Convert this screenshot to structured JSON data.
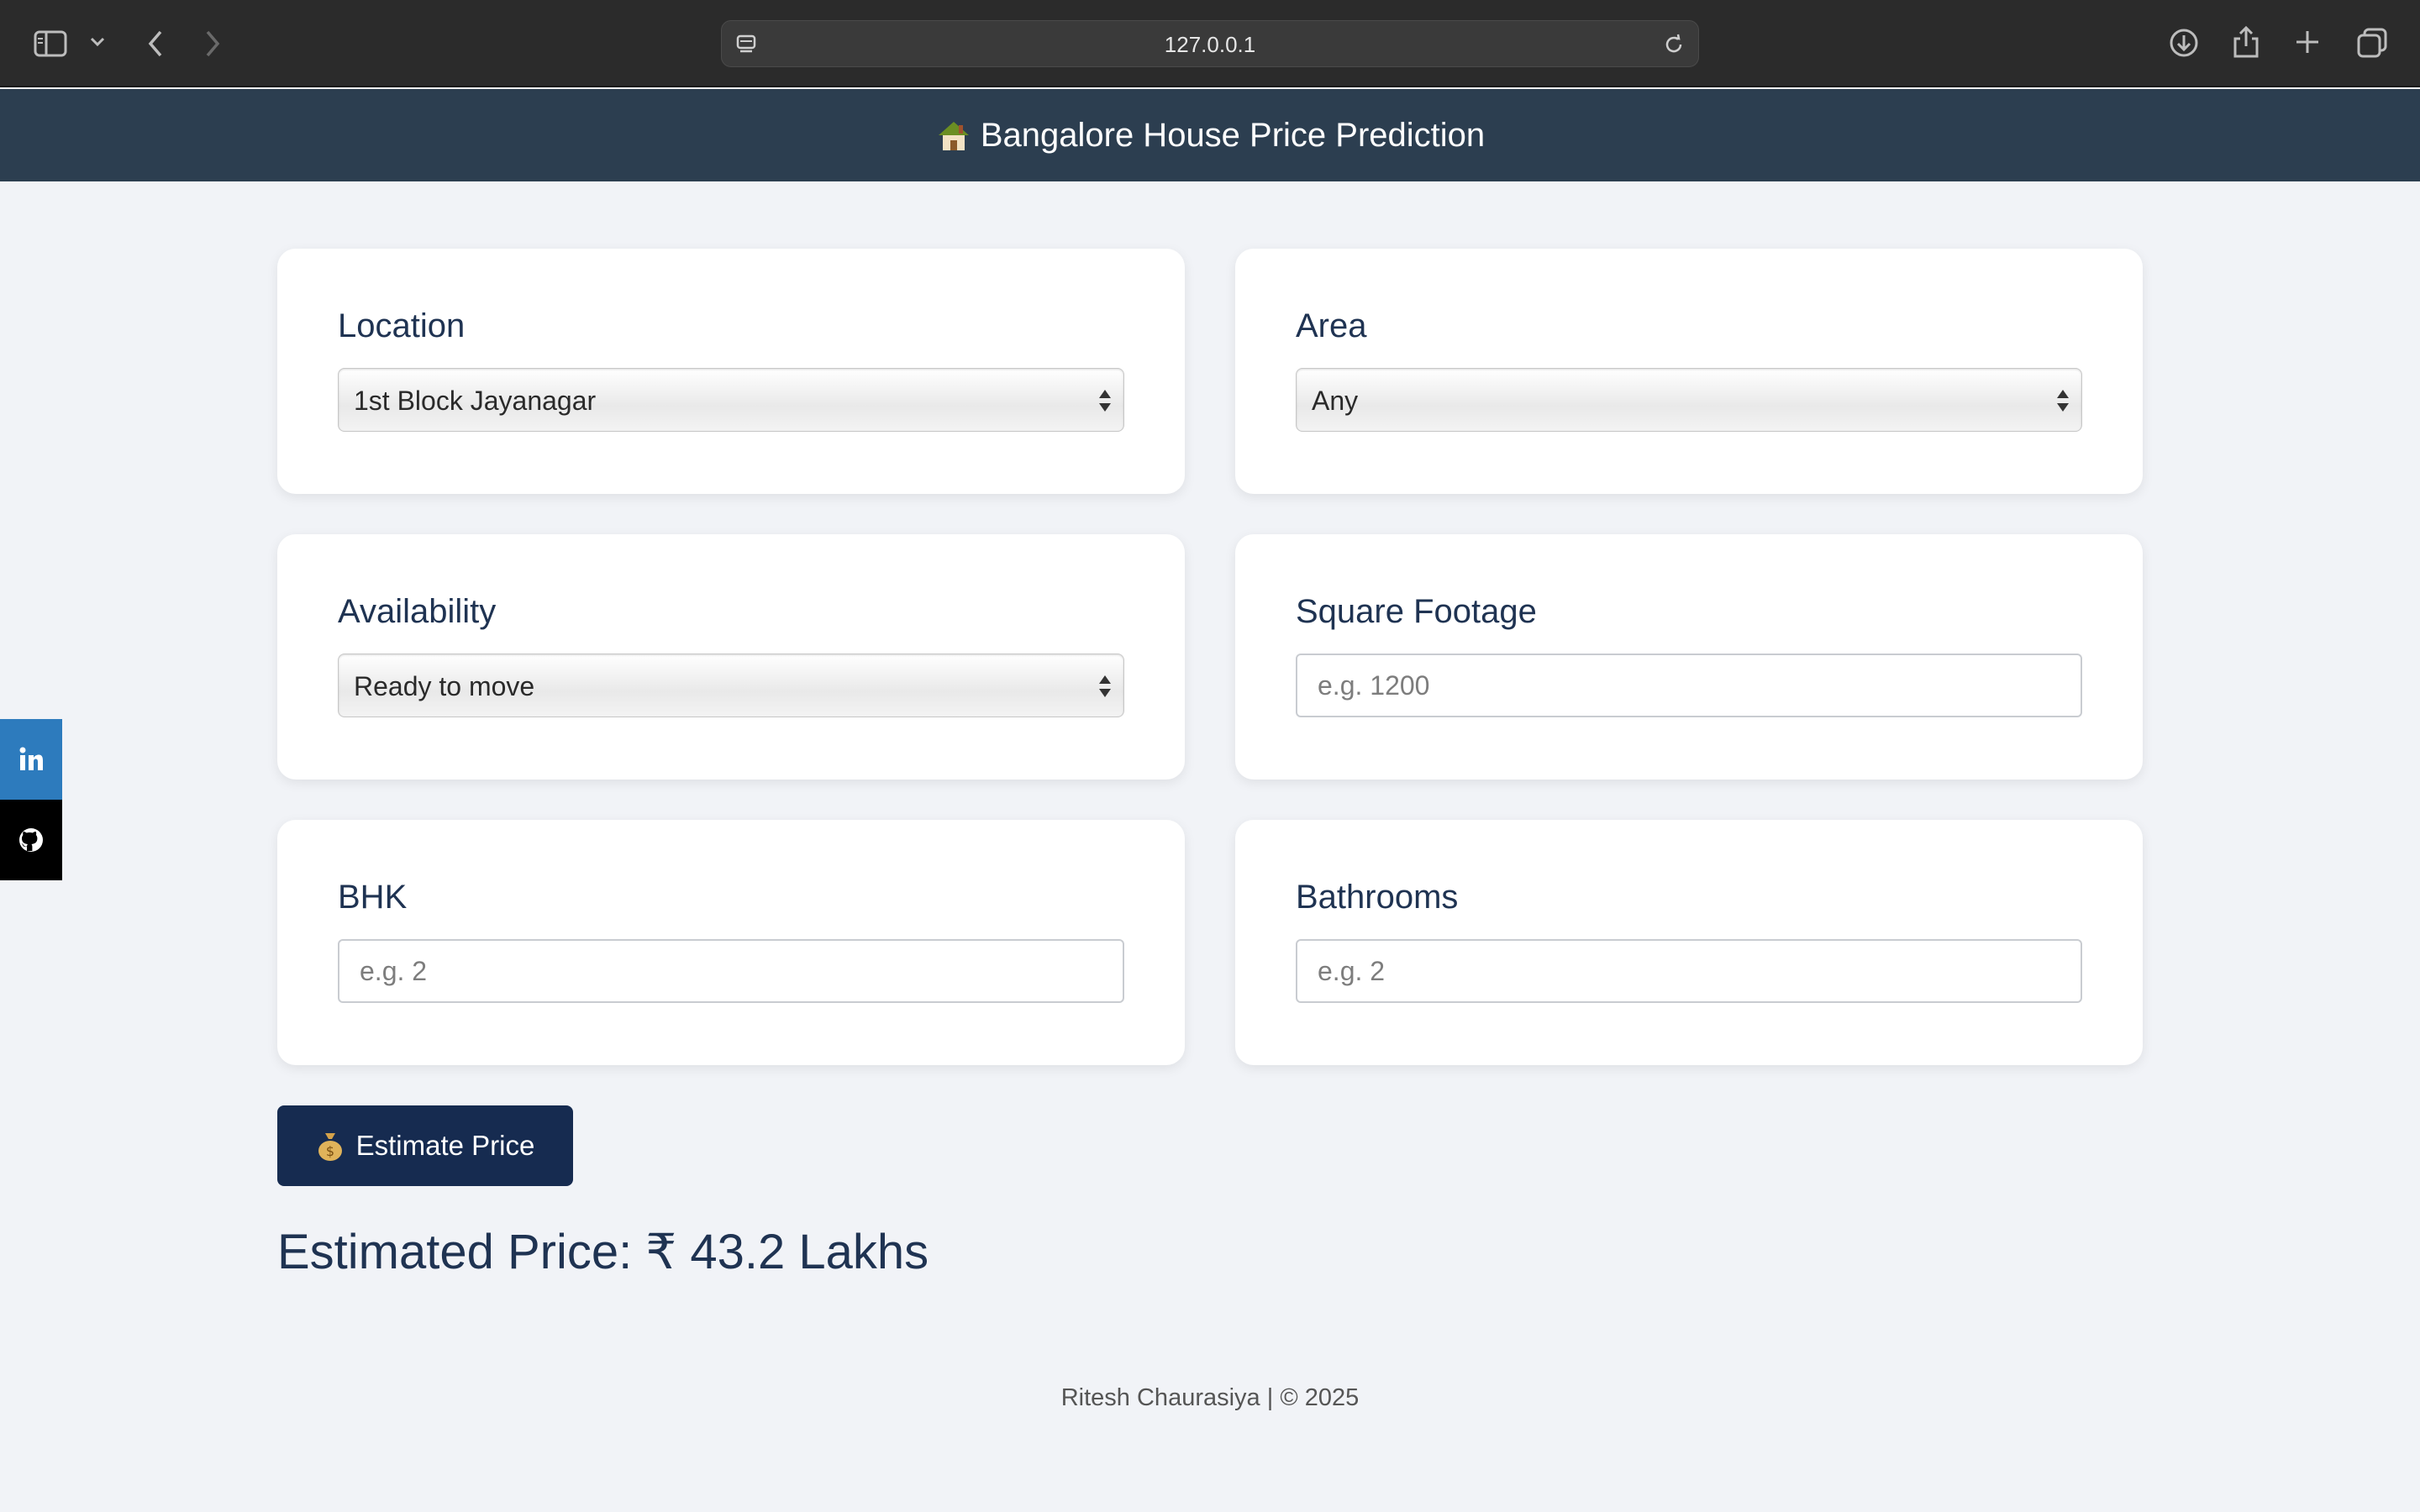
{
  "browser": {
    "url": "127.0.0.1"
  },
  "header": {
    "title": "Bangalore House Price Prediction"
  },
  "form": {
    "location": {
      "label": "Location",
      "value": "1st Block Jayanagar"
    },
    "area": {
      "label": "Area",
      "value": "Any"
    },
    "availability": {
      "label": "Availability",
      "value": "Ready to move"
    },
    "sqft": {
      "label": "Square Footage",
      "placeholder": "e.g. 1200"
    },
    "bhk": {
      "label": "BHK",
      "placeholder": "e.g. 2"
    },
    "bathrooms": {
      "label": "Bathrooms",
      "placeholder": "e.g. 2"
    }
  },
  "actions": {
    "estimate_label": "Estimate Price"
  },
  "result": {
    "text": "Estimated Price: ₹ 43.2 Lakhs"
  },
  "footer": {
    "text": "Ritesh Chaurasiya | © 2025"
  },
  "social": {
    "linkedin_color": "#2d7bbd",
    "github_color": "#000000"
  },
  "colors": {
    "header_bg": "#2c3e50",
    "button_bg": "#162b50",
    "page_bg": "#f1f3f7"
  }
}
